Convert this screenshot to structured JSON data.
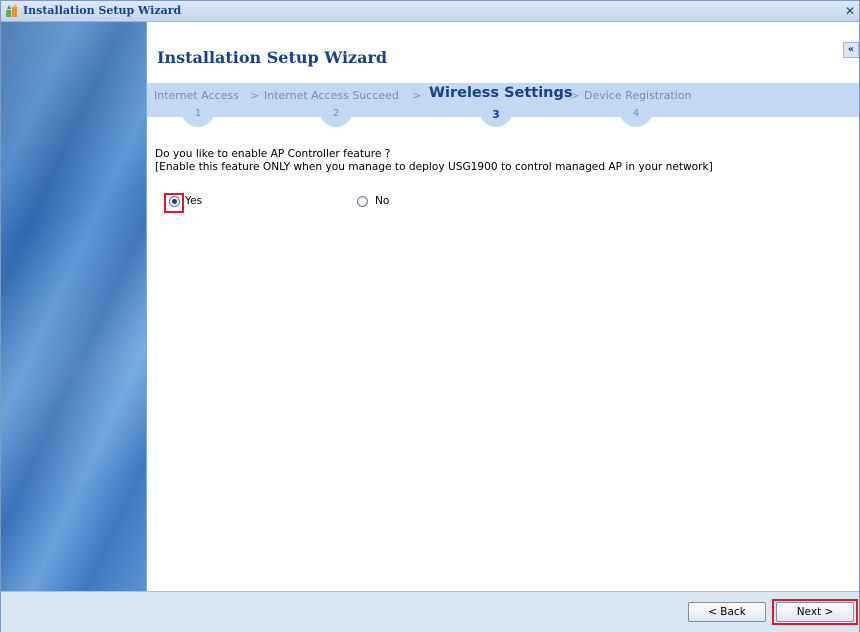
{
  "window": {
    "title": "Installation Setup Wizard",
    "close_glyph": "✕",
    "collapse_glyph": "«"
  },
  "header": {
    "title": "Installation Setup Wizard"
  },
  "steps": [
    {
      "label": "Internet Access",
      "number": "1",
      "active": false
    },
    {
      "label": "Internet Access Succeed",
      "number": "2",
      "active": false
    },
    {
      "label": "Wireless Settings",
      "number": "3",
      "active": true
    },
    {
      "label": "Device Registration",
      "number": "4",
      "active": false
    }
  ],
  "step_separator": ">",
  "form": {
    "question_line1": "Do you like to enable AP Controller feature ?",
    "question_line2": "[Enable this feature ONLY when you manage to deploy USG1900 to control managed AP in your network]",
    "options": [
      {
        "label": "Yes",
        "selected": true
      },
      {
        "label": "No",
        "selected": false
      }
    ]
  },
  "footer": {
    "back_label": "< Back",
    "next_label": "Next >"
  },
  "colors": {
    "title_blue": "#15428b",
    "highlight_red": "#e01b24",
    "steps_bar": "#c3d9f3"
  }
}
